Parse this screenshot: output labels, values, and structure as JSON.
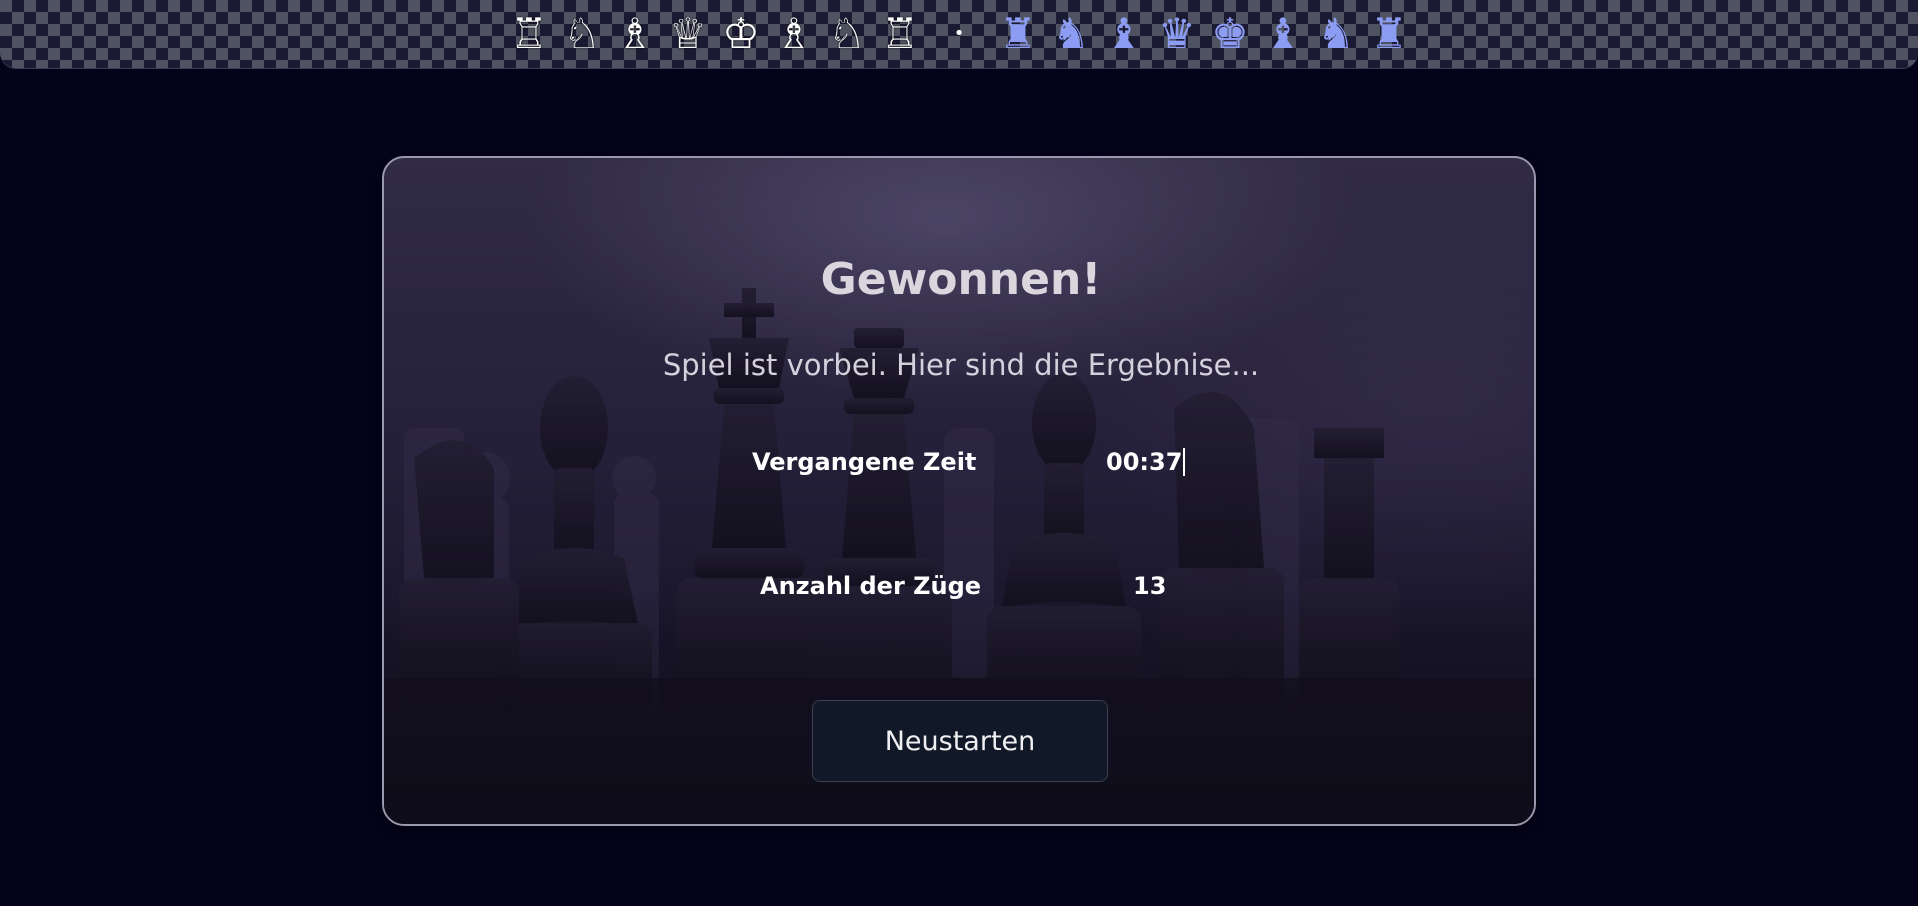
{
  "header": {
    "white_pieces": [
      {
        "glyph": "♖",
        "icon": "white-rook-icon"
      },
      {
        "glyph": "♘",
        "icon": "white-knight-icon"
      },
      {
        "glyph": "♗",
        "icon": "white-bishop-icon"
      },
      {
        "glyph": "♕",
        "icon": "white-queen-icon"
      },
      {
        "glyph": "♔",
        "icon": "white-king-icon"
      },
      {
        "glyph": "♗",
        "icon": "white-bishop-icon"
      },
      {
        "glyph": "♘",
        "icon": "white-knight-icon"
      },
      {
        "glyph": "♖",
        "icon": "white-rook-icon"
      }
    ],
    "separator": "•",
    "blue_pieces": [
      {
        "glyph": "♜",
        "icon": "blue-rook-icon"
      },
      {
        "glyph": "♞",
        "icon": "blue-knight-icon"
      },
      {
        "glyph": "♝",
        "icon": "blue-bishop-icon"
      },
      {
        "glyph": "♛",
        "icon": "blue-queen-icon"
      },
      {
        "glyph": "♚",
        "icon": "blue-king-icon"
      },
      {
        "glyph": "♝",
        "icon": "blue-bishop-icon"
      },
      {
        "glyph": "♞",
        "icon": "blue-knight-icon"
      },
      {
        "glyph": "♜",
        "icon": "blue-rook-icon"
      }
    ],
    "colors": {
      "white": "#ffffff",
      "blue": "#8c9cf3",
      "dark_square": "#1b1a33",
      "light_square": "#4f5361"
    }
  },
  "result": {
    "title": "Gewonnen!",
    "subtitle": "Spiel ist vorbei. Hier sind die Ergebnise...",
    "stats": {
      "time_label": "Vergangene Zeit",
      "time_value": "00:37",
      "moves_label": "Anzahl der Züge",
      "moves_value": "13"
    },
    "restart_label": "Neustarten"
  },
  "colors": {
    "page_background": "#05031a",
    "button_background": "#111827",
    "card_border": "#9a98ad"
  }
}
